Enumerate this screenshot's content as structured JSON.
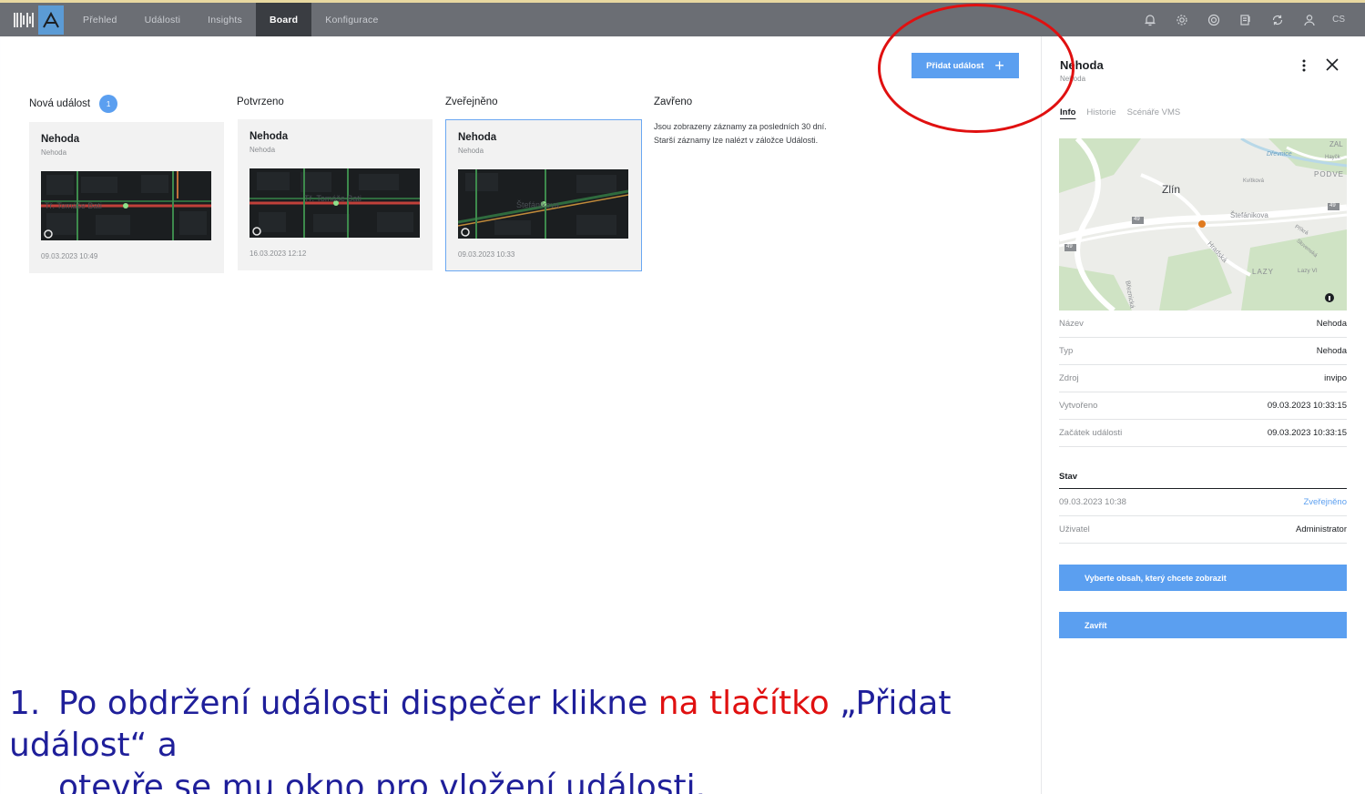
{
  "nav": {
    "logo_icon": "grid-logo-icon",
    "app_icon": "a-logo-icon",
    "items": [
      {
        "label": "Přehled",
        "active": false
      },
      {
        "label": "Události",
        "active": false
      },
      {
        "label": "Insights",
        "active": false
      },
      {
        "label": "Board",
        "active": true
      },
      {
        "label": "Konfigurace",
        "active": false
      }
    ],
    "icons": [
      "bell-icon",
      "gear-icon",
      "lifebuoy-icon",
      "report-icon",
      "sync-icon",
      "user-icon"
    ],
    "lang": "CS"
  },
  "board": {
    "add_button": "Přidat událost",
    "columns": [
      {
        "title": "Nová událost",
        "count": "1"
      },
      {
        "title": "Potvrzeno"
      },
      {
        "title": "Zveřejněno"
      },
      {
        "title": "Zavřeno"
      }
    ],
    "cards": [
      {
        "title": "Nehoda",
        "subtitle": "Nehoda",
        "map_label": "Tř. Tomáše Bati",
        "date": "09.03.2023 10:49"
      },
      {
        "title": "Nehoda",
        "subtitle": "Nehoda",
        "map_label": "Tř. Tomáše Bati",
        "date": "16.03.2023 12:12"
      },
      {
        "title": "Nehoda",
        "subtitle": "Nehoda",
        "map_label": "Štefánikova",
        "date": "09.03.2023 10:33"
      }
    ],
    "closed_note": "Jsou zobrazeny záznamy za posledních 30 dní. Starší záznamy lze nalézt v záložce Události."
  },
  "panel": {
    "title": "Nehoda",
    "subtitle": "Nehoda",
    "tabs": [
      "Info",
      "Historie",
      "Scénáře VMS"
    ],
    "map": {
      "city": "Zlín",
      "labels": [
        "Štefánikova",
        "Dřevnice",
        "Hradská",
        "LAZY",
        "PODVE",
        "ZAL",
        "Lazy VI",
        "Březnická",
        "Kvítková",
        "Slovenská",
        "Příkrá",
        "Hayčk"
      ],
      "road_numbers": [
        "49",
        "49",
        "49",
        "49"
      ]
    },
    "fields": [
      {
        "key": "Název",
        "value": "Nehoda"
      },
      {
        "key": "Typ",
        "value": "Nehoda"
      },
      {
        "key": "Zdroj",
        "value": "invipo"
      },
      {
        "key": "Vytvořeno",
        "value": "09.03.2023 10:33:15"
      },
      {
        "key": "Začátek události",
        "value": "09.03.2023 10:33:15"
      }
    ],
    "status_heading": "Stav",
    "status_rows": [
      {
        "key": "09.03.2023 10:38",
        "value": "Zveřejněno"
      },
      {
        "key": "Uživatel",
        "value": "Administrator"
      }
    ],
    "select_button": "Vyberte obsah, který chcete zobrazit",
    "close_button": "Zavřít"
  },
  "caption": {
    "number": "1.",
    "before": "Po obdržení události dispečer klikne ",
    "highlight": "na tlačítko",
    "after": " „Přidat událost“ a",
    "line2": "otevře se mu okno pro vložení události."
  },
  "colors": {
    "nav_bg": "#6b6e74",
    "nav_active": "#3a3d42",
    "accent": "#5b9ff0",
    "annotation_red": "#e01010",
    "caption_blue": "#1f1f9a"
  }
}
